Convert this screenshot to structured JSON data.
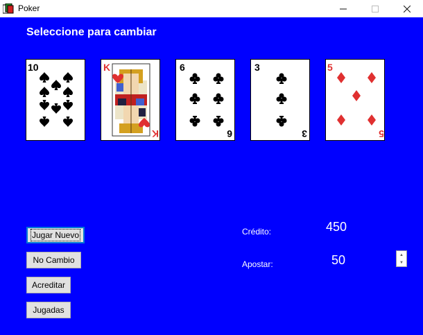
{
  "window": {
    "title": "Poker"
  },
  "main": {
    "heading": "Seleccione para cambiar",
    "cards": [
      {
        "rank": "10",
        "suit": "spades"
      },
      {
        "rank": "K",
        "suit": "hearts"
      },
      {
        "rank": "6",
        "suit": "clubs"
      },
      {
        "rank": "3",
        "suit": "clubs"
      },
      {
        "rank": "5",
        "suit": "diamonds"
      }
    ]
  },
  "buttons": {
    "jugar_nuevo": "Jugar Nuevo",
    "no_cambio": "No Cambio",
    "acreditar": "Acreditar",
    "jugadas": "Jugadas"
  },
  "credit": {
    "label": "Crédito:",
    "value": "450"
  },
  "bet": {
    "label": "Apostar:",
    "value": "50"
  },
  "colors": {
    "background": "#0000ff",
    "red_suit": "#e03030",
    "black_suit": "#000000"
  }
}
